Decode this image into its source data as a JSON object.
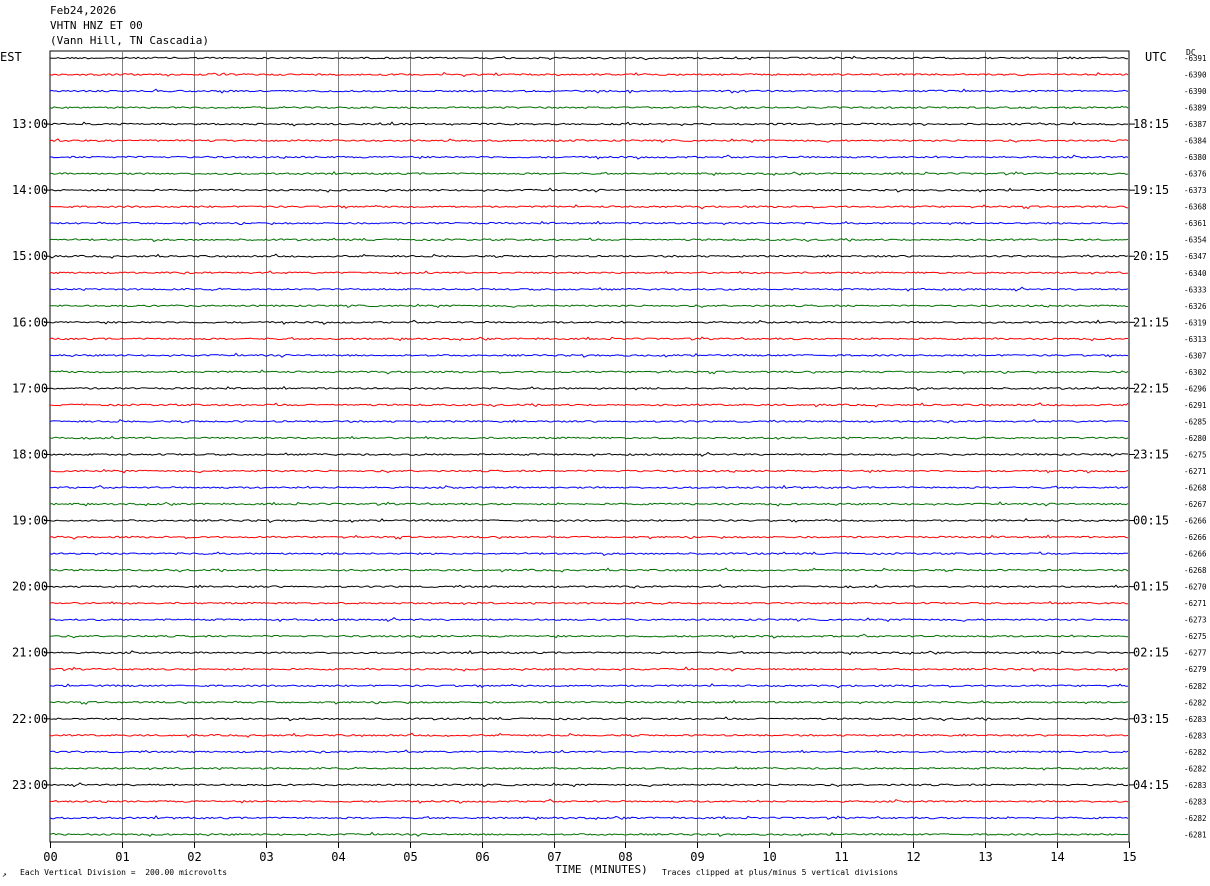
{
  "header": {
    "date": "Feb24,2026",
    "station": "VHTN HNZ ET 00",
    "location": "(Vann Hill, TN Cascadia)"
  },
  "left_axis_label": "EST",
  "right_axis_label": "UTC",
  "dc_label": "DC",
  "footer": {
    "scale_note": "Each Vertical Division =  200.00 microvolts",
    "xlabel": "TIME (MINUTES)",
    "clip_note": "Traces clipped at plus/minus 5 vertical divisions"
  },
  "chart_data": {
    "type": "line",
    "title": "VHTN HNZ ET 00",
    "xlabel": "TIME (MINUTES)",
    "x_ticks": [
      "00",
      "01",
      "02",
      "03",
      "04",
      "05",
      "06",
      "07",
      "08",
      "09",
      "10",
      "11",
      "12",
      "13",
      "14",
      "15"
    ],
    "xlim": [
      0,
      15
    ],
    "trace_colors": [
      "#000000",
      "#ff0000",
      "#0000ff",
      "#007000"
    ],
    "traces_per_hour": 4,
    "left_hour_labels": [
      "13:00",
      "14:00",
      "15:00",
      "16:00",
      "17:00",
      "18:00",
      "19:00",
      "20:00",
      "21:00",
      "22:00",
      "23:00"
    ],
    "right_hour_labels": [
      "18:15",
      "19:15",
      "20:15",
      "21:15",
      "22:15",
      "23:15",
      "00:15",
      "01:15",
      "02:15",
      "03:15",
      "04:15"
    ],
    "dc_offsets": [
      "-6391",
      "-6390",
      "-6390",
      "-6389",
      "-6387",
      "-6384",
      "-6380",
      "-6376",
      "-6373",
      "-6368",
      "-6361",
      "-6354",
      "-6347",
      "-6340",
      "-6333",
      "-6326",
      "-6319",
      "-6313",
      "-6307",
      "-6302",
      "-6296",
      "-6291",
      "-6285",
      "-6280",
      "-6275",
      "-6271",
      "-6268",
      "-6267",
      "-6266",
      "-6266",
      "-6266",
      "-6268",
      "-6270",
      "-6271",
      "-6273",
      "-6275",
      "-6277",
      "-6279",
      "-6282",
      "-6282",
      "-6283",
      "-6283",
      "-6282",
      "-6282",
      "-6283",
      "-6283",
      "-6282",
      "-6281"
    ],
    "vertical_division_microvolts": 200.0,
    "clip_divisions": 5,
    "grid": true
  }
}
